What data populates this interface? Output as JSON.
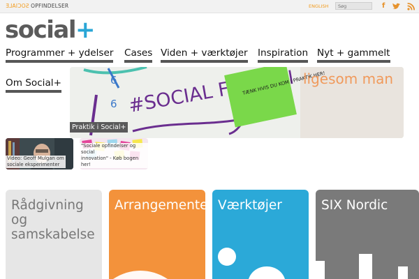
{
  "topbar": {
    "brand_mirrored": "SOCIALE",
    "brand_rest": "OPFINDELSER",
    "language_link": "ENGLISH",
    "search_placeholder": "Søg",
    "social_icons": [
      "facebook-icon",
      "twitter-icon",
      "rss-icon"
    ]
  },
  "logo": {
    "text": "social",
    "plus": "+"
  },
  "nav": {
    "items": [
      "Programmer + ydelser",
      "Cases",
      "Viden + værktøjer",
      "Inspiration",
      "Nyt + gammelt",
      "Om Social+"
    ]
  },
  "hero": {
    "caption": "Praktik i Social+",
    "whiteboard_text": "#SOCIAL FANTASI",
    "note_text": "TÆNK HVIS DU KOM I PRAKTIK HER!",
    "background_text": "ligesom man"
  },
  "thumbnails": [
    {
      "caption_line1": "Video: Geoff Mulgan om",
      "caption_line2": "sociale eksperimenter"
    },
    {
      "caption_line1": "\"Sociale opfindelser og social",
      "caption_line2": "innovation\" - Køb bogen her!"
    }
  ],
  "tiles": [
    {
      "title_line1": "Rådgivning",
      "title_line2": "og",
      "title_line3": "samskabelse",
      "color": "#e6e6e6"
    },
    {
      "title_line1": "Arrangementer",
      "color": "#f3923b"
    },
    {
      "title_line1": "Værktøjer",
      "color": "#2ba9d8"
    },
    {
      "title_line1": "SIX Nordic",
      "color": "#7a7a7a"
    }
  ],
  "colors": {
    "accent_orange": "#f39b1c",
    "accent_blue": "#2aa6d6",
    "nav_underline": "#565656"
  }
}
